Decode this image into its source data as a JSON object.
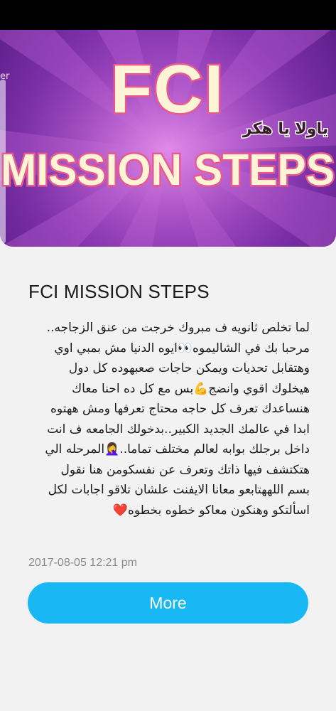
{
  "banner": {
    "side_text": "er",
    "title_line1": "FCI",
    "title_line2": "MISSION STEPS",
    "tagline": "ياولا يا هكر",
    "colors": {
      "background_center": "#d46fe0",
      "background_edge": "#5e1f8a",
      "title_fill": "#fff4d6",
      "title_shadow": "#e85a8c",
      "tagline_color": "#3a1a2a"
    }
  },
  "post": {
    "title": "FCI MISSION STEPS",
    "body_lines": [
      "لما تخلص ثانويه ف مبروك خرجت من عنق الزجاجه..",
      "مرحبا بك في الشاليموه👀ايوه الدنيا مش بمبي اوي",
      "وهتقابل تحديات ويمكن حاجات صعبهوده كل دول",
      "هيخلوك اقوي وانضج💪بس مع كل ده احنا معاك",
      "هنساعدك تعرف كل حاجه محتاج تعرفها ومش ههتوه",
      "ابدا في عالمك الجديد الكبير..بدخولك الجامعه ف انت",
      "داخل برجلك بوابه لعالم مختلف تماما..🤦‍♀️المرحله الي",
      "هتكتشف فيها ذاتك وتعرف عن نفسكومن هنا نقول",
      "بسم اللههتابعو معانا الايفنت علشان تلاقو اجابات لكل",
      "اسألتكو وهنكون معاكو خطوه بخطوه❤️"
    ],
    "date": "2017-08-05 12:21 pm",
    "more_label": "More",
    "button_color": "#18b8f5"
  }
}
